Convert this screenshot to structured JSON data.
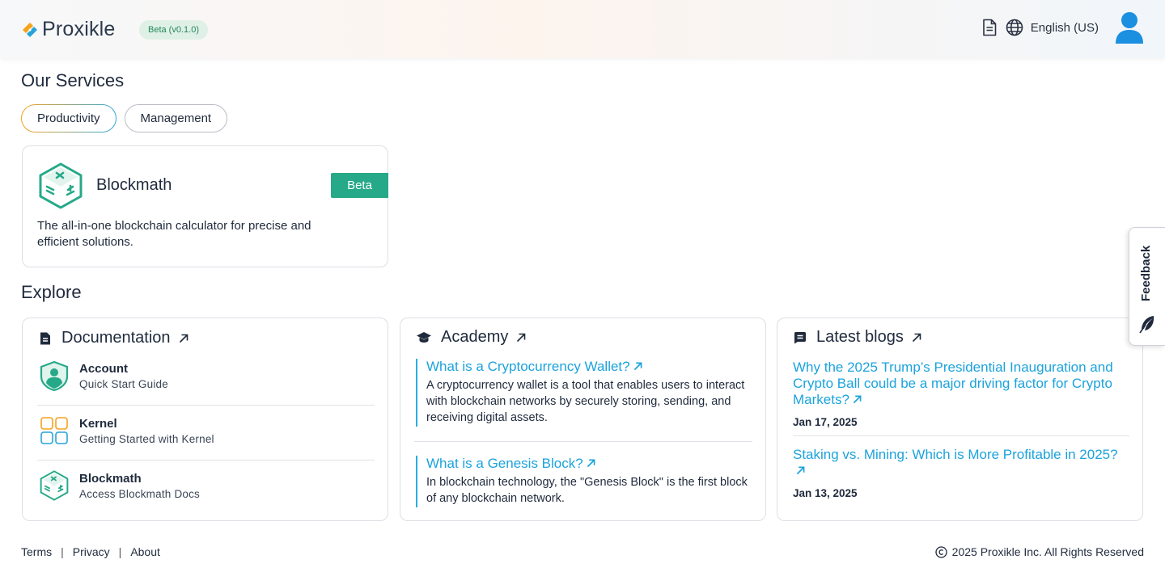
{
  "header": {
    "logo_text": "Proxikle",
    "version_badge": "Beta (v0.1.0)",
    "language": "English (US)"
  },
  "services": {
    "title": "Our Services",
    "tabs": [
      {
        "label": "Productivity",
        "active": true
      },
      {
        "label": "Management",
        "active": false
      }
    ],
    "card": {
      "name": "Blockmath",
      "badge": "Beta",
      "description": "The all-in-one blockchain calculator for precise and efficient solutions."
    }
  },
  "explore": {
    "title": "Explore",
    "documentation": {
      "title": "Documentation",
      "items": [
        {
          "title": "Account",
          "subtitle": "Quick Start Guide",
          "icon": "shield-user-icon"
        },
        {
          "title": "Kernel",
          "subtitle": "Getting Started with Kernel",
          "icon": "kernel-grid-icon"
        },
        {
          "title": "Blockmath",
          "subtitle": "Access Blockmath Docs",
          "icon": "blockmath-icon"
        }
      ]
    },
    "academy": {
      "title": "Academy",
      "items": [
        {
          "title": "What is a Cryptocurrency Wallet?",
          "description": "A cryptocurrency wallet is a tool that enables users to interact with blockchain networks by securely storing, sending, and receiving digital assets."
        },
        {
          "title": "What is a Genesis Block?",
          "description": "In blockchain technology, the \"Genesis Block\" is the first block of any blockchain network."
        }
      ]
    },
    "blogs": {
      "title": "Latest blogs",
      "items": [
        {
          "title": "Why the 2025 Trump’s Presidential Inauguration and Crypto Ball could be a major driving factor for Crypto Markets?",
          "date": "Jan 17, 2025"
        },
        {
          "title": "Staking vs. Mining: Which is More Profitable in 2025?",
          "date": "Jan 13, 2025"
        }
      ]
    }
  },
  "feedback": {
    "label": "Feedback"
  },
  "footer": {
    "links": [
      "Terms",
      "Privacy",
      "About"
    ],
    "copyright": "2025 Proxikle Inc. All Rights Reserved"
  },
  "colors": {
    "accent_green": "#26a989",
    "link_blue": "#1ba3dc",
    "orange": "#f5a21d",
    "text_dark": "#1f2a3c"
  }
}
